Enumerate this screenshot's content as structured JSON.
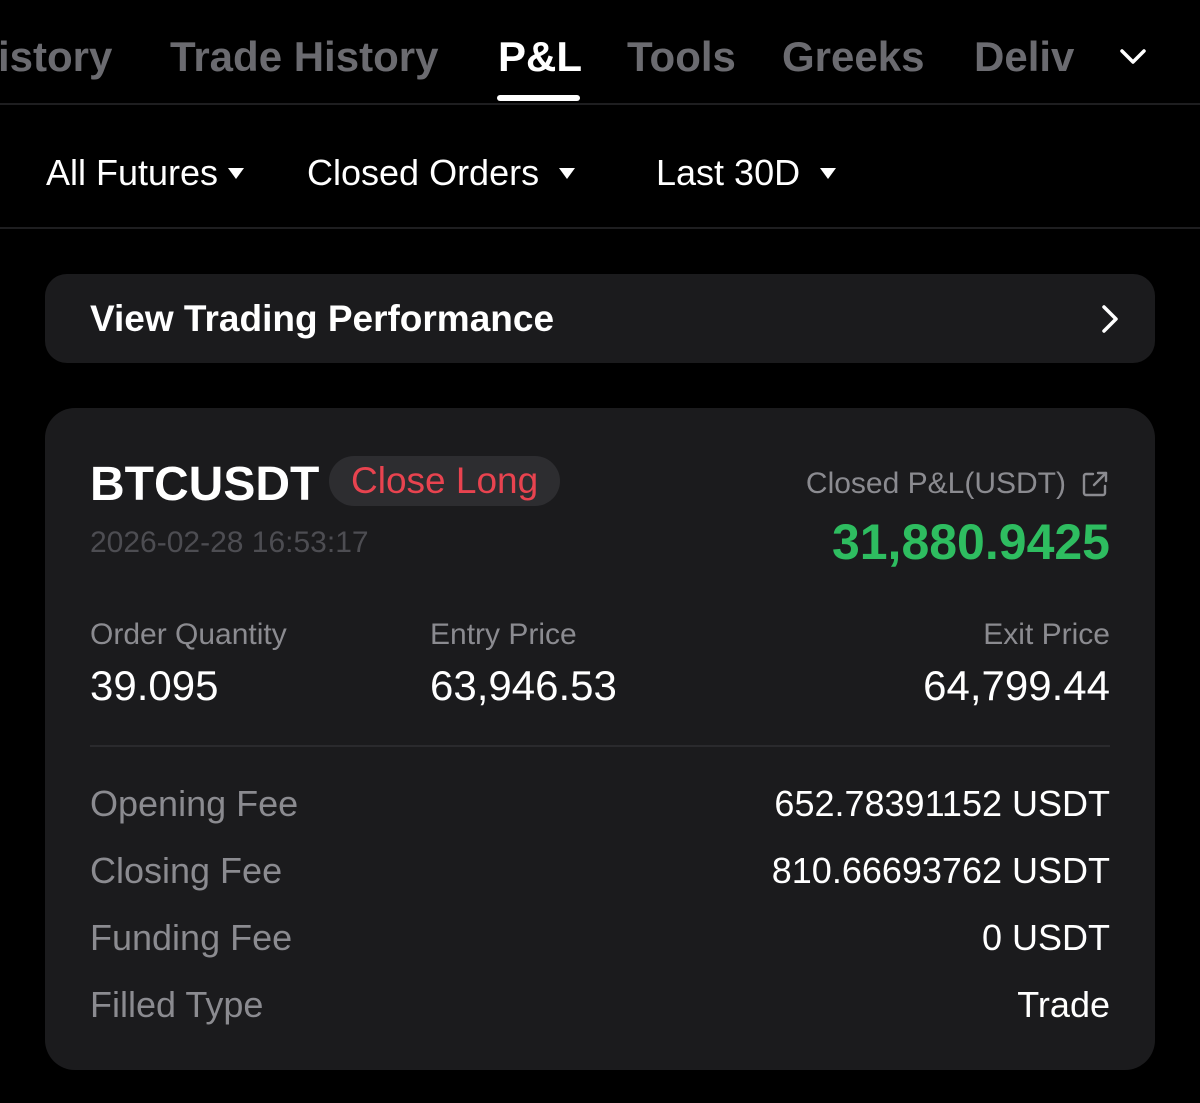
{
  "tabs": [
    {
      "label": "istory",
      "active": false
    },
    {
      "label": "Trade History",
      "active": false
    },
    {
      "label": "P&L",
      "active": true
    },
    {
      "label": "Tools",
      "active": false
    },
    {
      "label": "Greeks",
      "active": false
    },
    {
      "label": "Deliv",
      "active": false
    }
  ],
  "tabs_more_icon": "chevron-down-icon",
  "filters": {
    "futures": "All Futures",
    "orders": "Closed Orders",
    "period": "Last 30D"
  },
  "performance_link": {
    "label": "View Trading Performance",
    "icon": "chevron-right-icon"
  },
  "card": {
    "symbol": "BTCUSDT",
    "badge": "Close Long",
    "timestamp": "2026-02-28 16:53:17",
    "pnl_label": "Closed P&L(USDT)",
    "pnl_value": "31,880.9425",
    "order_quantity_label": "Order Quantity",
    "order_quantity": "39.095",
    "entry_price_label": "Entry Price",
    "entry_price": "63,946.53",
    "exit_price_label": "Exit Price",
    "exit_price": "64,799.44",
    "fees": [
      {
        "label": "Opening Fee",
        "value": "652.78391152 USDT"
      },
      {
        "label": "Closing Fee",
        "value": "810.66693762 USDT"
      },
      {
        "label": "Funding Fee",
        "value": "0 USDT"
      },
      {
        "label": "Filled Type",
        "value": "Trade"
      }
    ]
  },
  "colors": {
    "background": "#000000",
    "panel": "#1b1b1d",
    "profit": "#2ebd60",
    "loss_badge": "#e8434f",
    "muted_text": "#8b8b90"
  }
}
